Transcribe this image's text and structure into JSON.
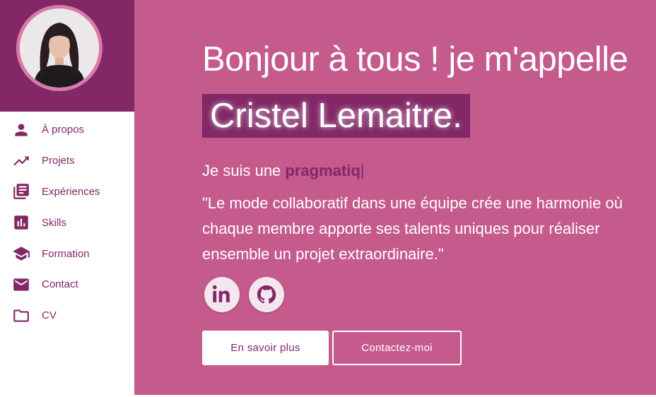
{
  "sidebar": {
    "avatar_alt": "Cristel Lemaitre",
    "items": [
      {
        "label": "À propos",
        "icon": "person-icon"
      },
      {
        "label": "Projets",
        "icon": "trending-up-icon"
      },
      {
        "label": "Expériences",
        "icon": "library-books-icon"
      },
      {
        "label": "Skills",
        "icon": "bar-chart-icon"
      },
      {
        "label": "Formation",
        "icon": "school-icon"
      },
      {
        "label": "Contact",
        "icon": "mail-icon"
      },
      {
        "label": "CV",
        "icon": "folder-icon"
      }
    ]
  },
  "hero": {
    "greeting": "Bonjour à tous ! je m'appelle",
    "name": "Cristel Lemaitre.",
    "role_prefix": "Je suis une",
    "role_word": "pragmatiq",
    "caret": "|",
    "quote": "\"Le mode collaboratif dans une équipe crée une harmonie où chaque membre apporte ses talents uniques pour réaliser ensemble un projet extraordinaire.\"",
    "socials": [
      {
        "name": "linkedin-icon"
      },
      {
        "name": "github-icon"
      }
    ],
    "primary_button": "En savoir plus",
    "secondary_button": "Contactez-moi"
  },
  "colors": {
    "accent": "#822867",
    "background": "#c55a8c",
    "avatar_ring": "#d97aa8"
  }
}
